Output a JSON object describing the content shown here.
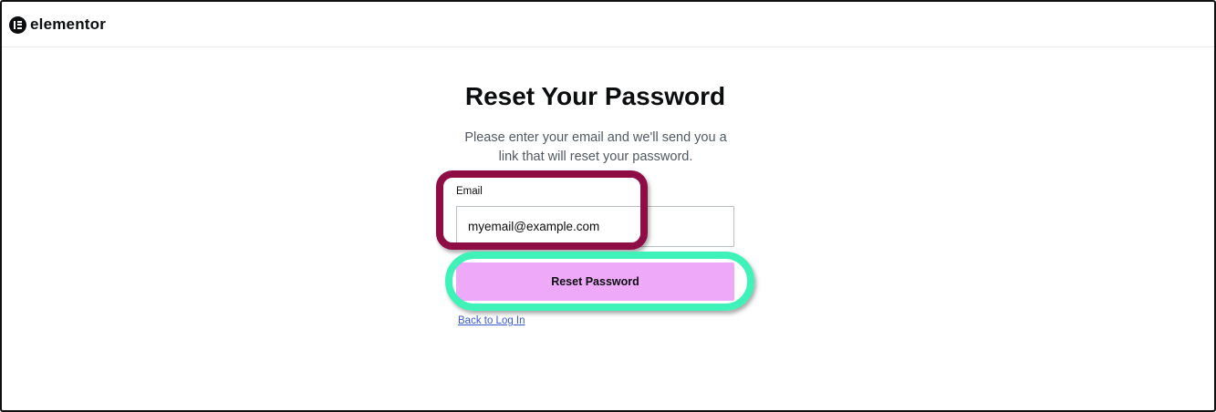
{
  "header": {
    "logo_text": "elementor",
    "logo_icon": "elementor-logo-icon"
  },
  "main": {
    "title": "Reset Your Password",
    "subtitle": "Please enter your email and we'll send you a link that will reset your password.",
    "email_label": "Email",
    "email_value": "myemail@example.com",
    "reset_button_label": "Reset Password",
    "back_link_label": "Back to Log In"
  },
  "annotations": {
    "email_highlight_color": "#8e0d45",
    "button_highlight_color": "#3ef2b8"
  },
  "colors": {
    "button_background": "#eeaaf9",
    "link": "#3a5bd6",
    "text_primary": "#0c0d0e",
    "text_secondary": "#515962"
  }
}
